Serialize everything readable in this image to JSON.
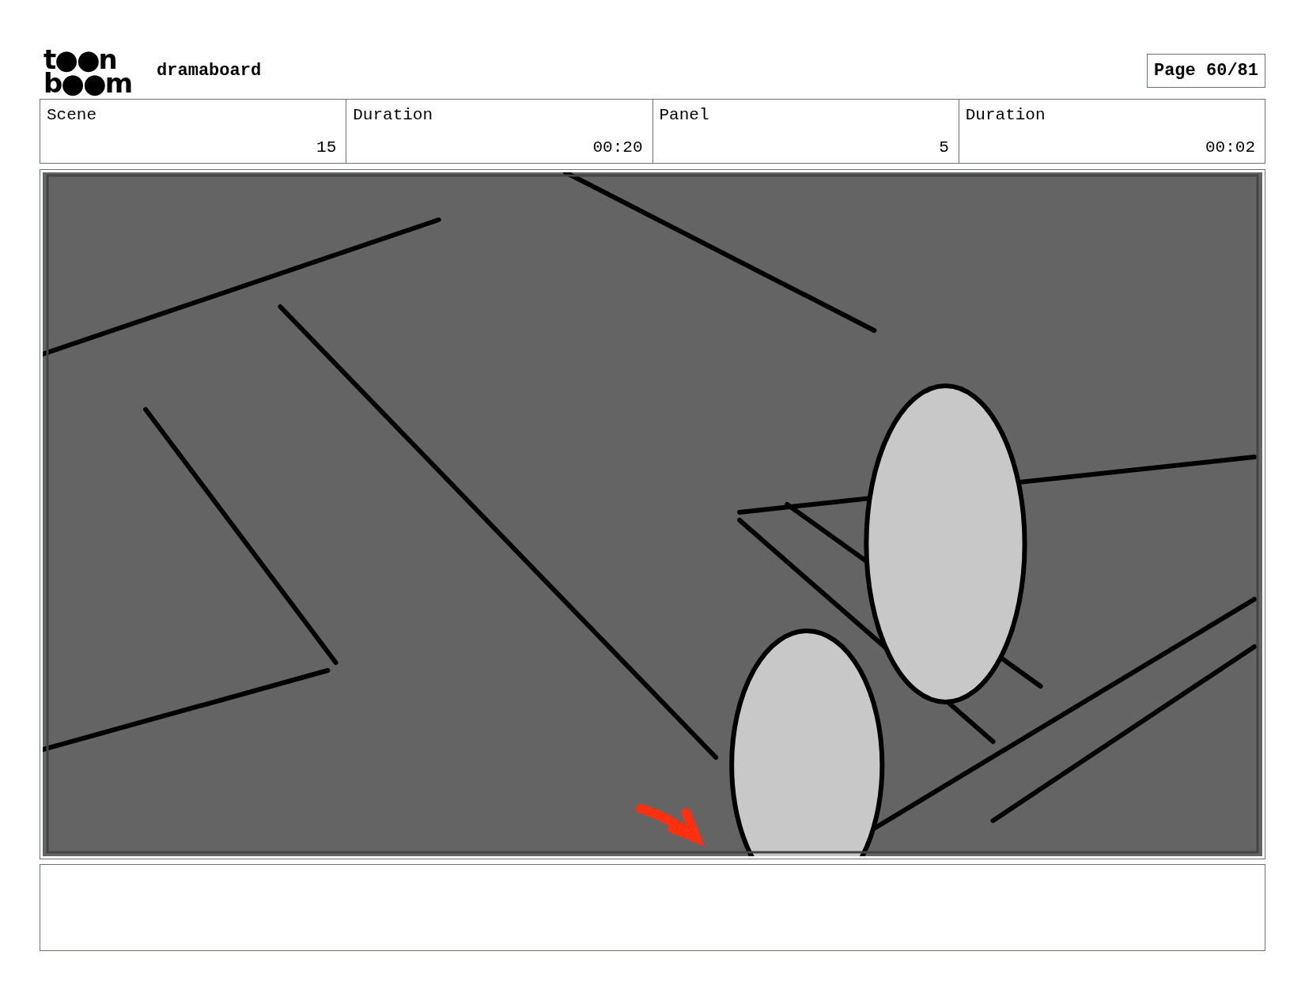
{
  "logo": {
    "line_1": "t●●n",
    "line_2": "b●●m"
  },
  "app_name": "dramaboard",
  "page": "Page 60/81",
  "fields": [
    {
      "label": "Scene",
      "value": "15"
    },
    {
      "label": "Duration",
      "value": "00:20"
    },
    {
      "label": "Panel",
      "value": "5"
    },
    {
      "label": "Duration",
      "value": "00:02"
    }
  ]
}
